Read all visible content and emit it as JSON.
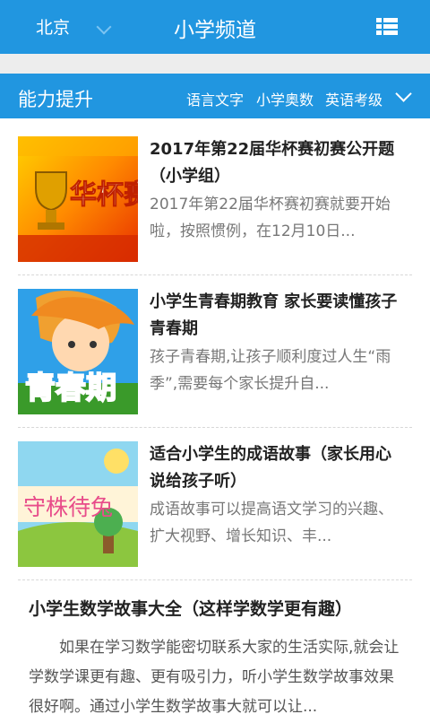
{
  "header": {
    "city": "北京",
    "title": "小学频道"
  },
  "category": {
    "title": "能力提升",
    "tabs": [
      "语言文字",
      "小学奥数",
      "英语考级"
    ]
  },
  "items": [
    {
      "thumb_text": "华杯赛",
      "title": "2017年第22届华杯赛初赛公开题（小学组）",
      "summary": "2017年第22届华杯赛初赛就要开始啦，按照惯例，在12月10日..."
    },
    {
      "thumb_text": "青春期",
      "title": "小学生青春期教育 家长要读懂孩子青春期",
      "summary": "孩子青春期,让孩子顺利度过人生“雨季”,需要每个家长提升自..."
    },
    {
      "thumb_text": "守株待兔",
      "title": "适合小学生的成语故事（家长用心说给孩子听）",
      "summary": "成语故事可以提高语文学习的兴趣、扩大视野、增长知识、丰..."
    }
  ],
  "article": {
    "title": "小学生数学故事大全（这样学数学更有趣）",
    "body": "如果在学习数学能密切联系大家的生活实际,就会让学数学课更有趣、更有吸引力，听小学生数学故事效果很好啊。通过小学生数学故事大就可以让..."
  }
}
